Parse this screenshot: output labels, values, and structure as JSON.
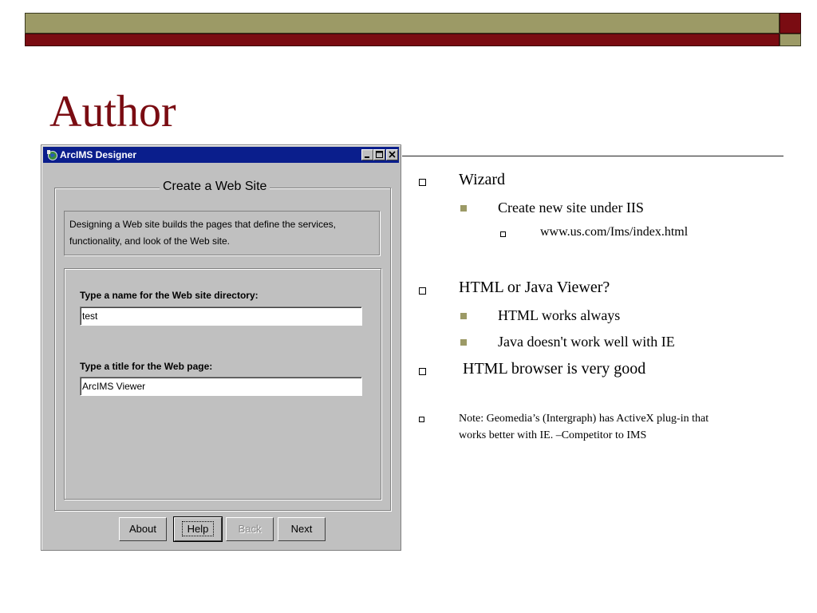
{
  "slide": {
    "title": "Author"
  },
  "dialog": {
    "window_title": "ArcIMS Designer",
    "group_caption": "Create a Web Site",
    "info_text": "Designing a Web site builds the pages that define the services, functionality, and look of the Web site.",
    "dir_label": "Type a name for the Web site directory:",
    "dir_value": "test",
    "title_label": "Type a title for the Web page:",
    "title_value": "ArcIMS Viewer",
    "buttons": {
      "about": "About",
      "help": "Help",
      "back": "Back",
      "next": "Next"
    }
  },
  "bullets": {
    "b1": "Wizard",
    "b1_1": "Create new site under IIS",
    "b1_1_1": "www.us.com/Ims/index.html",
    "b2": "HTML or Java Viewer?",
    "b2_1": "HTML works always",
    "b2_2": "Java doesn't work well with IE",
    "b3": " HTML browser is very good",
    "b4_line1": "Note: Geomedia’s (Intergraph) has ActiveX plug-in that",
    "b4_line2": "works better with IE. –Competitor to IMS"
  },
  "colors": {
    "olive": "#9c9a66",
    "maroon": "#7a0c12",
    "titlebar": "#0a1e8c"
  }
}
